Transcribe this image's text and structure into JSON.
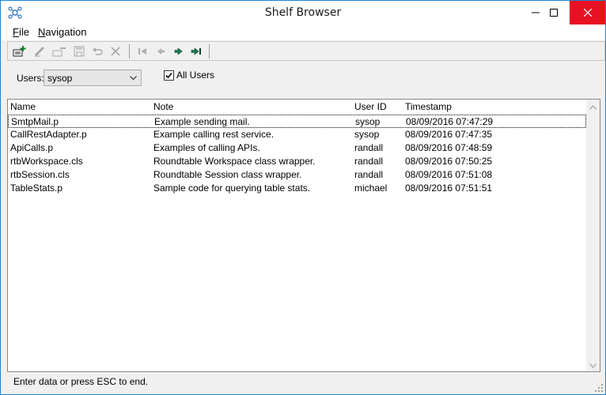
{
  "window": {
    "title": "Shelf Browser"
  },
  "menu": {
    "file": {
      "mnemonic": "F",
      "rest": "ile"
    },
    "navigation": {
      "mnemonic": "N",
      "rest": "avigation"
    }
  },
  "toolbar": {
    "buttons": [
      "add-icon",
      "edit-icon",
      "remove-icon",
      "save-icon",
      "undo-icon",
      "delete-icon",
      "first-icon",
      "previous-icon",
      "next-icon",
      "last-icon"
    ]
  },
  "filter": {
    "users_label": "Users:",
    "users_value": "sysop",
    "all_users_label": "All Users",
    "all_users_checked": true
  },
  "table": {
    "columns": [
      "Name",
      "Note",
      "User ID",
      "Timestamp"
    ],
    "rows": [
      {
        "name": "SmtpMail.p",
        "note": "Example sending mail.",
        "user": "sysop",
        "timestamp": "08/09/2016 07:47:29"
      },
      {
        "name": "CallRestAdapter.p",
        "note": "Example calling rest service.",
        "user": "sysop",
        "timestamp": "08/09/2016 07:47:35"
      },
      {
        "name": "ApiCalls.p",
        "note": "Examples of calling APIs.",
        "user": "randall",
        "timestamp": "08/09/2016 07:48:59"
      },
      {
        "name": "rtbWorkspace.cls",
        "note": "Roundtable Workspace class wrapper.",
        "user": "randall",
        "timestamp": "08/09/2016 07:50:25"
      },
      {
        "name": "rtbSession.cls",
        "note": "Roundtable Session class wrapper.",
        "user": "randall",
        "timestamp": "08/09/2016 07:51:08"
      },
      {
        "name": "TableStats.p",
        "note": "Sample code for querying table stats.",
        "user": "michael",
        "timestamp": "08/09/2016 07:51:51"
      }
    ]
  },
  "status": {
    "text": "Enter data or press ESC to end."
  },
  "colors": {
    "close_button": "#e81123",
    "window_border": "#1883d7",
    "nav_arrow": "#1a7a50"
  }
}
